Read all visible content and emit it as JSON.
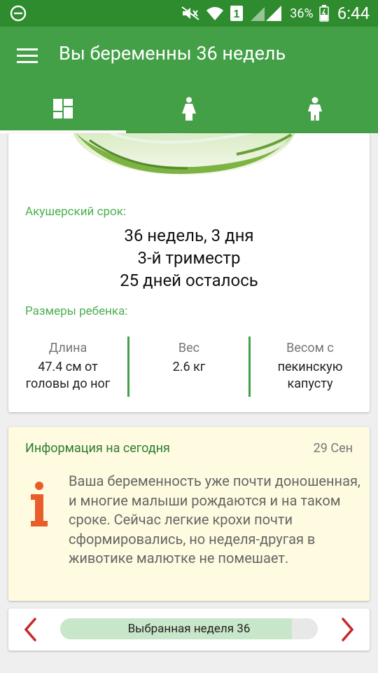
{
  "status_bar": {
    "battery_percent": "36%",
    "time": "6:44",
    "sim_slot": "1",
    "icons": [
      "do-not-disturb-icon",
      "mute-icon",
      "wifi-icon",
      "sim-icon",
      "signal-icon",
      "battery-icon"
    ]
  },
  "app_bar": {
    "title": "Вы беременны 36 недель",
    "menu_icon": "hamburger-menu-icon"
  },
  "tabs": [
    {
      "icon": "dashboard-icon",
      "active": true
    },
    {
      "icon": "woman-icon",
      "active": false
    },
    {
      "icon": "child-icon",
      "active": false
    }
  ],
  "summary_card": {
    "image": "chinese-cabbage",
    "term_label": "Акушерский срок:",
    "term_weeks": "36 недель, 3 дня",
    "trimester": "3-й триместр",
    "days_left": "25 дней осталось",
    "sizes_label": "Размеры ребенка:",
    "sizes": [
      {
        "title": "Длина",
        "value": "47.4 см от головы до ног"
      },
      {
        "title": "Вес",
        "value": "2.6 кг"
      },
      {
        "title": "Весом с",
        "value": "пекинскую капусту"
      }
    ]
  },
  "info_card": {
    "title": "Информация на сегодня",
    "date": "29 Сен",
    "icon": "info-icon",
    "text": "Ваша беременность уже почти доношенная, и многие малыши рождаются и на таком сроке. Сейчас легкие крохи почти сформировались, но неделя-другая в животике малютке не помешает."
  },
  "week_selector": {
    "label": "Выбранная неделя 36",
    "progress_fraction": 0.9,
    "prev_icon": "chevron-left-icon",
    "next_icon": "chevron-right-icon"
  },
  "colors": {
    "status_bar": "#2e8b2e",
    "primary": "#43a047",
    "accent_text": "#4caf50",
    "info_background": "#fffbe0",
    "info_icon": "#e85d2a",
    "arrow": "#c62828",
    "progress_fill": "#c8e6c9"
  }
}
